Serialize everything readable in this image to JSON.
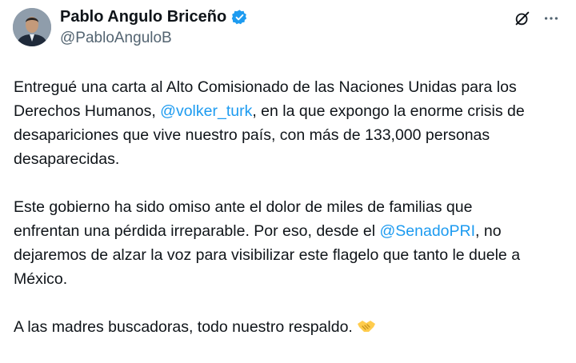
{
  "author": {
    "name": "Pablo Angulo Briceño",
    "handle": "@PabloAnguloB",
    "verified": true,
    "brand_color": "#1d9bf0"
  },
  "icons": [
    "grok-icon",
    "more-icon",
    "verified-badge-icon",
    "handshake-emoji"
  ],
  "tweet": {
    "p1": {
      "a": "Entregué una carta al Alto Comisionado de las Naciones Unidas para los",
      "b": "Derechos Humanos, ",
      "mention": "@volker_turk",
      "c": ", en la que expongo la enorme crisis de",
      "d": "desapariciones que vive nuestro país, con más de 133,000 personas",
      "e": "desaparecidas."
    },
    "p2": {
      "a": "Este gobierno ha sido omiso ante el dolor de miles de familias que",
      "b": "enfrentan una pérdida irreparable. Por eso, desde el ",
      "mention": "@SenadoPRI",
      "c": ", no",
      "d": "dejaremos de alzar la voz para visibilizar este flagelo que tanto le duele a",
      "e": "México."
    },
    "p3": {
      "a": "A las madres buscadoras, todo nuestro respaldo."
    }
  }
}
